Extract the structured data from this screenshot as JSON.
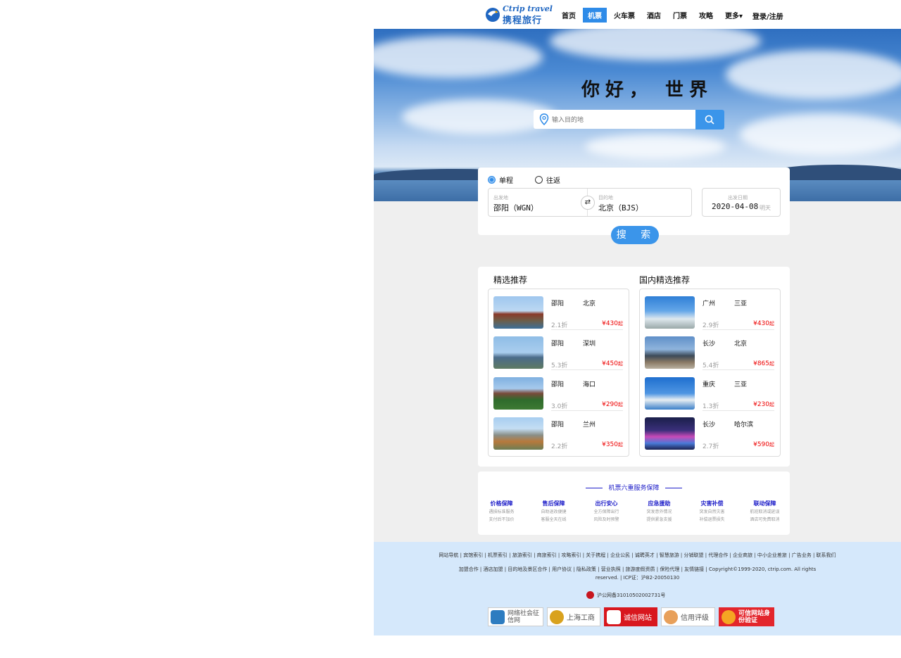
{
  "header": {
    "logo_en": "Ctrip travel",
    "logo_cn": "携程旅行",
    "nav": [
      "首页",
      "机票",
      "火车票",
      "酒店",
      "门票",
      "攻略",
      "更多▾"
    ],
    "active_nav": "机票",
    "login": "登录/注册"
  },
  "hero": {
    "title": "你好， 世界",
    "search_placeholder": "输入目的地"
  },
  "booking": {
    "trip_types": [
      "单程",
      "往返"
    ],
    "selected_trip": "单程",
    "from_label": "出发地",
    "from_value": "邵阳（WGN）",
    "to_label": "目的地",
    "to_value": "北京（BJS）",
    "date_label": "出发日期",
    "date_value": "2020-04-08",
    "date_hint": "明天",
    "search_button": "搜 索"
  },
  "recommend": {
    "left_title": "精选推荐",
    "right_title": "国内精选推荐",
    "left": [
      {
        "from": "邵阳",
        "to": "北京",
        "discount": "2.1折",
        "price": "¥430",
        "suffix": "起"
      },
      {
        "from": "邵阳",
        "to": "深圳",
        "discount": "5.3折",
        "price": "¥450",
        "suffix": "起"
      },
      {
        "from": "邵阳",
        "to": "海口",
        "discount": "3.0折",
        "price": "¥290",
        "suffix": "起"
      },
      {
        "from": "邵阳",
        "to": "兰州",
        "discount": "2.2折",
        "price": "¥350",
        "suffix": "起"
      }
    ],
    "right": [
      {
        "from": "广州",
        "to": "三亚",
        "discount": "2.9折",
        "price": "¥430",
        "suffix": "起"
      },
      {
        "from": "长沙",
        "to": "北京",
        "discount": "5.4折",
        "price": "¥865",
        "suffix": "起"
      },
      {
        "from": "重庆",
        "to": "三亚",
        "discount": "1.3折",
        "price": "¥230",
        "suffix": "起"
      },
      {
        "from": "长沙",
        "to": "哈尔滨",
        "discount": "2.7折",
        "price": "¥590",
        "suffix": "起"
      }
    ]
  },
  "service": {
    "title": "机票六重服务保障",
    "items": [
      {
        "title": "价格保障",
        "line1": "遇损标准服务",
        "line2": "支付后不加价"
      },
      {
        "title": "售后保障",
        "line1": "自助退改便捷",
        "line2": "客服全天在线"
      },
      {
        "title": "出行安心",
        "line1": "全方保障出行",
        "line2": "风险及时预警"
      },
      {
        "title": "应急援助",
        "line1": "突发意外情况",
        "line2": "提供紧急支援"
      },
      {
        "title": "灾害补偿",
        "line1": "突发自然灾害",
        "line2": "补偿退票损失"
      },
      {
        "title": "联动保障",
        "line1": "航班取消或延误",
        "line2": "酒店可免费取消"
      }
    ]
  },
  "footer": {
    "links1": "网站导航 | 宾馆索引 | 机票索引 | 旅游索引 | 商旅索引 | 攻略索引 | 关于携程 | 企业公民 | 诚聘英才 | 智慧旅游 | 分销联盟 | 代理合作 | 企业商旅 | 中小企业差旅 | 广告业务 | 联系我们",
    "links2": "加盟合作 | 酒店加盟 | 目的地及景区合作 | 用户协议 | 隐私政策 | 营业执照 | 旅游度假资质 | 保险代理 | 友情链接 | Copyright©1999-2020, ctrip.com. All rights",
    "links3": "reserved. | ICP证：沪B2-20050130",
    "police": "沪公网备31010502002731号",
    "badges": [
      "网络社会征信网",
      "上海工商",
      "诚信网站",
      "信用评级",
      "可信网站身份验证"
    ]
  },
  "colors": {
    "accent": "#3b95ea",
    "price": "#e00000",
    "service_blue": "#1c1cc8",
    "footer_bg": "#d5e8fb",
    "gray_bg": "#efefef"
  }
}
